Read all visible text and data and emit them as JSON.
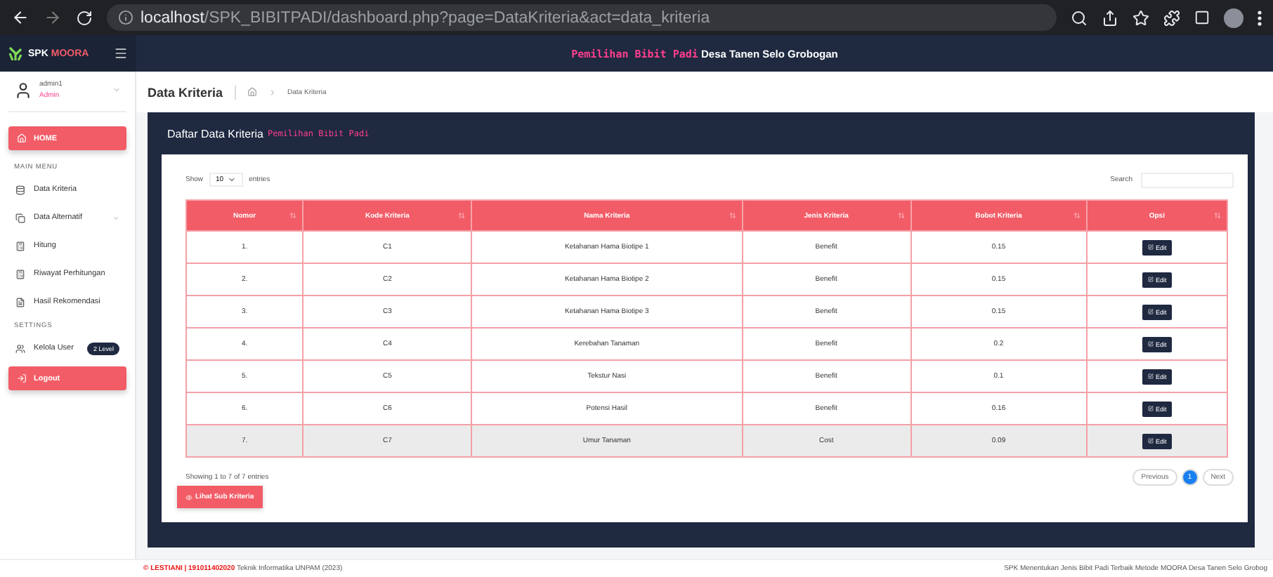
{
  "browser": {
    "url_host": "localhost",
    "url_path": "/SPK_BIBITPADI/dashboard.php?page=DataKriteria&act=data_kriteria"
  },
  "header": {
    "brand_a": "SPK",
    "brand_b": "MOORA",
    "title_accent": "Pemilihan Bibit Padi",
    "title_rest": "Desa Tanen Selo Grobogan"
  },
  "user": {
    "name": "admin1",
    "role": "Admin"
  },
  "sidebar": {
    "items": [
      {
        "kind": "primary",
        "label": "HOME"
      },
      {
        "kind": "section",
        "label": "MAIN MENU"
      },
      {
        "kind": "link",
        "label": "Data Kriteria"
      },
      {
        "kind": "link",
        "label": "Data Alternatif",
        "caret": true
      },
      {
        "kind": "link",
        "label": "Hitung"
      },
      {
        "kind": "link",
        "label": "Riwayat Perhitungan"
      },
      {
        "kind": "link",
        "label": "Hasil Rekomendasi"
      },
      {
        "kind": "section",
        "label": "SETTINGS"
      },
      {
        "kind": "link",
        "label": "Kelola User",
        "badge": "2 Level"
      },
      {
        "kind": "primary",
        "label": "Logout"
      }
    ]
  },
  "page": {
    "title": "Data Kriteria",
    "breadcrumb": "Data Kriteria"
  },
  "card": {
    "title": "Daftar Data Kriteria",
    "title_accent": "Pemilihan Bibit Padi"
  },
  "table": {
    "show_label": "Show",
    "page_size": "10",
    "entries_label": "entries",
    "search_label": "Search",
    "columns": [
      "Nomor",
      "Kode Kriteria",
      "Nama Kriteria",
      "Jenis Kriteria",
      "Bobot Kriteria",
      "Opsi"
    ],
    "rows": [
      {
        "cells": [
          "1.",
          "C1",
          "Ketahanan Hama Biotipe 1",
          "Benefit",
          "0.15"
        ],
        "action": "Edit",
        "highlighted": false
      },
      {
        "cells": [
          "2.",
          "C2",
          "Ketahanan Hama Biotipe 2",
          "Benefit",
          "0.15"
        ],
        "action": "Edit",
        "highlighted": false
      },
      {
        "cells": [
          "3.",
          "C3",
          "Ketahanan Hama Biotipe 3",
          "Benefit",
          "0.15"
        ],
        "action": "Edit",
        "highlighted": false
      },
      {
        "cells": [
          "4.",
          "C4",
          "Kerebahan Tanaman",
          "Benefit",
          "0.2"
        ],
        "action": "Edit",
        "highlighted": false
      },
      {
        "cells": [
          "5.",
          "C5",
          "Tekstur Nasi",
          "Benefit",
          "0.1"
        ],
        "action": "Edit",
        "highlighted": false
      },
      {
        "cells": [
          "6.",
          "C6",
          "Potensi Hasil",
          "Benefit",
          "0.16"
        ],
        "action": "Edit",
        "highlighted": false
      },
      {
        "cells": [
          "7.",
          "C7",
          "Umur Tanaman",
          "Cost",
          "0.09"
        ],
        "action": "Edit",
        "highlighted": true
      }
    ],
    "info": "Showing 1 to 7 of 7 entries",
    "pagination": [
      {
        "label": "Previous",
        "kind": "nav",
        "selected": false
      },
      {
        "label": "1",
        "kind": "page",
        "selected": true
      },
      {
        "label": "Next",
        "kind": "nav",
        "selected": false
      }
    ]
  },
  "sub_button": "Lihat Sub Kriteria",
  "footer": {
    "author": "© LESTIANI | 191011402020",
    "rest": "Teknik Informatika UNPAM (2023)",
    "right": "SPK Menentukan Jenis Bibit Padi Terbaik Metode MOORA Desa Tanen Selo Grobog"
  }
}
